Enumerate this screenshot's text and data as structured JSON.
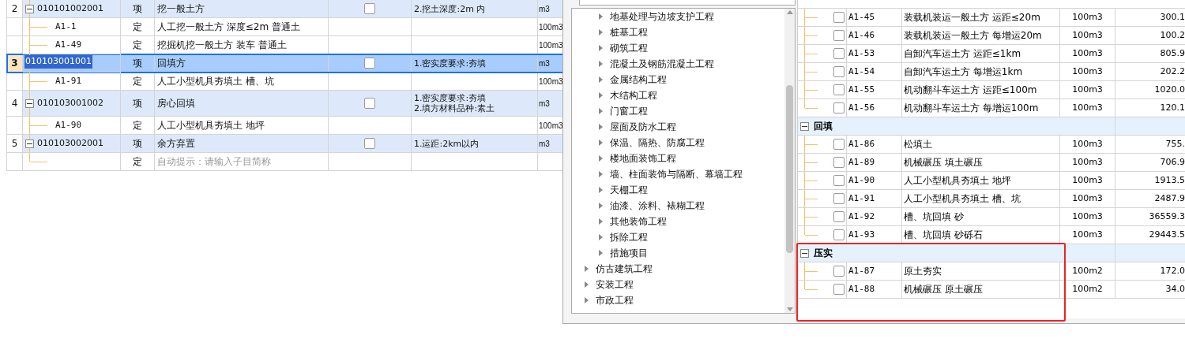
{
  "bill_table": {
    "rows": [
      {
        "kind": "item",
        "number": "2",
        "code": "010101002001",
        "type": "项",
        "name": "挖一般土方",
        "checked": false,
        "features": [
          "2.挖土深度:2m 内"
        ],
        "unit": "m3",
        "selected": false,
        "expanded": true
      },
      {
        "kind": "quota",
        "code": "A1-1",
        "type": "定",
        "name": "人工挖一般土方 深度≤2m 普通土",
        "unit": "100m3"
      },
      {
        "kind": "quota",
        "code": "A1-49",
        "type": "定",
        "name": "挖掘机挖一般土方 装车 普通土",
        "unit": "100m3"
      },
      {
        "kind": "item",
        "number": "3",
        "code": "010103001001",
        "type": "项",
        "name": "回填方",
        "checked": false,
        "features": [
          "1.密实度要求:夯填"
        ],
        "unit": "m3",
        "selected": true
      },
      {
        "kind": "quota",
        "code": "A1-91",
        "type": "定",
        "name": "人工小型机具夯填土 槽、坑",
        "unit": "100m3"
      },
      {
        "kind": "item",
        "number": "4",
        "code": "010103001002",
        "type": "项",
        "name": "房心回填",
        "checked": false,
        "features": [
          "1.密实度要求:夯填",
          "2.填方材料品种:素土"
        ],
        "unit": "m3",
        "selected": false,
        "expanded": true
      },
      {
        "kind": "quota",
        "code": "A1-90",
        "type": "定",
        "name": "人工小型机具夯填土 地坪",
        "unit": "100m3"
      },
      {
        "kind": "item",
        "number": "5",
        "code": "010103002001",
        "type": "项",
        "name": "余方弃置",
        "checked": false,
        "features": [
          "1.运距:2km以内"
        ],
        "unit": "m3",
        "selected": false,
        "expanded": true
      },
      {
        "kind": "hint",
        "type": "定",
        "hint": "自动提示：请输入子目简称"
      }
    ]
  },
  "category_tree": {
    "items": [
      {
        "children": [
          {
            "label": "地基处理与边坡支护工程"
          },
          {
            "label": "桩基工程"
          },
          {
            "label": "砌筑工程"
          },
          {
            "label": "混凝土及钢筋混凝土工程"
          },
          {
            "label": "金属结构工程"
          },
          {
            "label": "木结构工程"
          },
          {
            "label": "门窗工程"
          },
          {
            "label": "屋面及防水工程"
          },
          {
            "label": "保温、隔热、防腐工程"
          },
          {
            "label": "楼地面装饰工程"
          },
          {
            "label": "墙、柱面装饰与隔断、幕墙工程"
          },
          {
            "label": "天棚工程"
          },
          {
            "label": "油漆、涂料、裱糊工程"
          },
          {
            "label": "其他装饰工程"
          },
          {
            "label": "拆除工程"
          },
          {
            "label": "措施项目"
          }
        ]
      },
      {
        "label": "仿古建筑工程"
      },
      {
        "label": "安装工程"
      },
      {
        "label": "市政工程"
      }
    ]
  },
  "quota_list": {
    "groups": [
      {
        "rows": [
          {
            "code": "A1-45",
            "name": "装载机装运一般土方 运距≤20m",
            "unit": "100m3",
            "amount": "300.1",
            "checked": false
          },
          {
            "code": "A1-46",
            "name": "装载机装运一般土方 每增运20m",
            "unit": "100m3",
            "amount": "100.2",
            "checked": false
          },
          {
            "code": "A1-53",
            "name": "自卸汽车运土方 运距≤1km",
            "unit": "100m3",
            "amount": "805.9",
            "checked": false
          },
          {
            "code": "A1-54",
            "name": "自卸汽车运土方 每增运1km",
            "unit": "100m3",
            "amount": "202.2",
            "checked": false
          },
          {
            "code": "A1-55",
            "name": "机动翻斗车运土方 运距≤100m",
            "unit": "100m3",
            "amount": "1020.0",
            "checked": false
          },
          {
            "code": "A1-56",
            "name": "机动翻斗车运土方 每增运100m",
            "unit": "100m3",
            "amount": "120.1",
            "checked": false
          }
        ]
      },
      {
        "title": "回填",
        "expanded": true,
        "rows": [
          {
            "code": "A1-86",
            "name": "松填土",
            "unit": "100m3",
            "amount": "755.",
            "checked": false
          },
          {
            "code": "A1-89",
            "name": "机械碾压 填土碾压",
            "unit": "100m3",
            "amount": "706.9",
            "checked": false
          },
          {
            "code": "A1-90",
            "name": "人工小型机具夯填土 地坪",
            "unit": "100m3",
            "amount": "1913.5",
            "checked": false
          },
          {
            "code": "A1-91",
            "name": "人工小型机具夯填土 槽、坑",
            "unit": "100m3",
            "amount": "2487.9",
            "checked": false
          },
          {
            "code": "A1-92",
            "name": "槽、坑回填 砂",
            "unit": "100m3",
            "amount": "36559.3",
            "checked": false
          },
          {
            "code": "A1-93",
            "name": "槽、坑回填 砂砾石",
            "unit": "100m3",
            "amount": "29443.5",
            "checked": false
          }
        ]
      },
      {
        "title": "压实",
        "expanded": true,
        "rows": [
          {
            "code": "A1-87",
            "name": "原土夯实",
            "unit": "100m2",
            "amount": "172.0",
            "checked": false
          },
          {
            "code": "A1-88",
            "name": "机械碾压 原土碾压",
            "unit": "100m2",
            "amount": "34.0",
            "checked": false
          }
        ]
      }
    ]
  }
}
